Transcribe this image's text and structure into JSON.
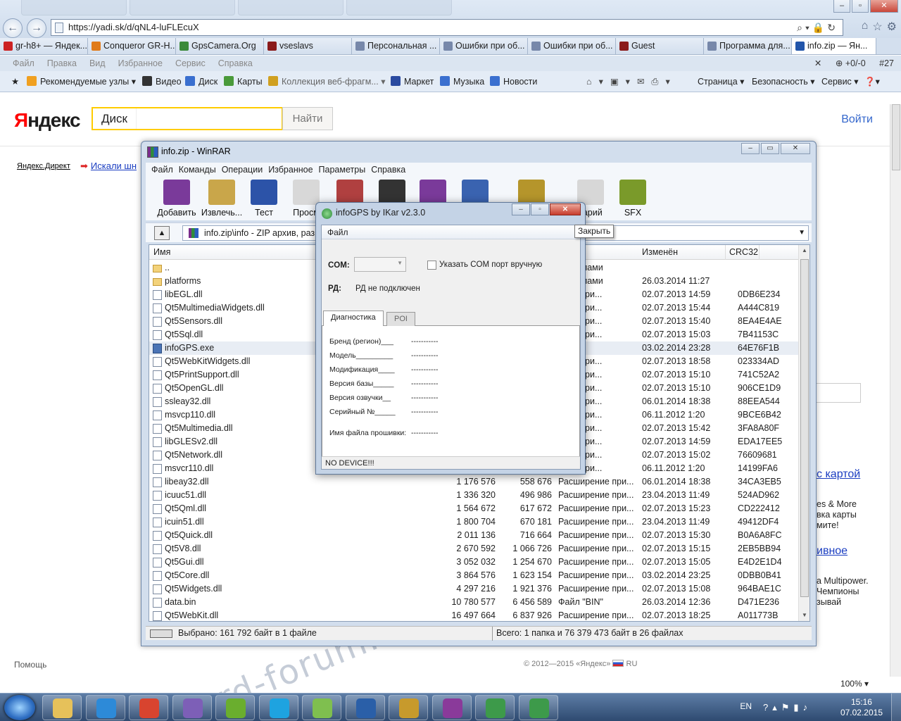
{
  "browser": {
    "address": "https://yadi.sk/d/qNL4-luFLEcuX",
    "tabs": [
      {
        "label": "gr-h8+ — Яндек...",
        "color": "#cc2222"
      },
      {
        "label": "Conqueror GR-H...",
        "color": "#e07b1a"
      },
      {
        "label": "GpsCamera.Org",
        "color": "#3a8a3a"
      },
      {
        "label": "vseslavs",
        "color": "#8a1a1a"
      },
      {
        "label": "Персональная ...",
        "color": "#7788aa"
      },
      {
        "label": "Ошибки при об...",
        "color": "#7788aa"
      },
      {
        "label": "Ошибки при об...",
        "color": "#7788aa"
      },
      {
        "label": "Guest",
        "color": "#8a1a1a"
      },
      {
        "label": "Программа для...",
        "color": "#7788aa"
      },
      {
        "label": "info.zip — Ян...",
        "color": "#2255aa"
      }
    ],
    "menu": [
      "Файл",
      "Правка",
      "Вид",
      "Избранное",
      "Сервис",
      "Справка"
    ],
    "menu_right": "+0/-0",
    "menu_right2": "#27",
    "favorites": [
      {
        "label": "Рекомендуемые узлы ▾",
        "gray": false
      },
      {
        "label": "Видео",
        "gray": false
      },
      {
        "label": "Диск",
        "gray": false
      },
      {
        "label": "Карты",
        "gray": false
      },
      {
        "label": "Коллекция веб-фрагм... ▾",
        "gray": true
      },
      {
        "label": "Маркет",
        "gray": false
      },
      {
        "label": "Музыка",
        "gray": false
      },
      {
        "label": "Новости",
        "gray": false
      }
    ],
    "commands": [
      "Страница ▾",
      "Безопасность ▾",
      "Сервис ▾"
    ]
  },
  "yandex": {
    "logo_red": "Я",
    "logo_rest": "ндекс",
    "search_tag": "Диск",
    "search_button": "Найти",
    "login": "Войти",
    "direct": "Яндекс.Директ",
    "link": "Искали шн",
    "right_link1": "с картой",
    "right_text1": [
      "es & More",
      "вка карты",
      "мите!"
    ],
    "right_link2": "ивное",
    "right_text2": [
      "а Multipower.",
      "Чемпионы",
      "зывай"
    ],
    "footer_left": "Помощь",
    "footer_right": "© 2012—2015 «Яндекс»",
    "footer_lang": "RU",
    "zoom": "100% ▾",
    "watermark": "rd-forum.ru"
  },
  "winrar": {
    "title": "info.zip - WinRAR",
    "menu": [
      "Файл",
      "Команды",
      "Операции",
      "Избранное",
      "Параметры",
      "Справка"
    ],
    "toolbar": [
      {
        "label": "Добавить",
        "color": "#7a3a9a"
      },
      {
        "label": "Извлечь...",
        "color": "#c9a64a"
      },
      {
        "label": "Тест",
        "color": "#2c53a8"
      },
      {
        "label": "Просм",
        "color": "#d8d8d8"
      },
      {
        "label": "",
        "color": "#b04040"
      },
      {
        "label": "",
        "color": "#333333"
      },
      {
        "label": "",
        "color": "#7a3a9a"
      },
      {
        "label": "",
        "color": "#3a63b0"
      },
      {
        "label": "",
        "color": "#b5952b"
      },
      {
        "label": "тарий",
        "color": "#d7d7d7"
      },
      {
        "label": "SFX",
        "color": "#7a9a2a"
      }
    ],
    "path": "info.zip\\info - ZIP архив, разм",
    "columns": {
      "name": "Имя",
      "modified": "Изменён",
      "crc": "CRC32"
    },
    "files": [
      {
        "name": "..",
        "size": "",
        "packed": "",
        "type": "с файлами",
        "modified": "",
        "crc": "",
        "kind": "dir"
      },
      {
        "name": "platforms",
        "size": "",
        "packed": "",
        "type": "с файлами",
        "modified": "26.03.2014 11:27",
        "crc": "",
        "kind": "dir"
      },
      {
        "name": "libEGL.dll",
        "size": "",
        "packed": "",
        "type": "ение при...",
        "modified": "02.07.2013 14:59",
        "crc": "0DB6E234",
        "kind": "file"
      },
      {
        "name": "Qt5MultimediaWidgets.dll",
        "size": "",
        "packed": "",
        "type": "ение при...",
        "modified": "02.07.2013 15:44",
        "crc": "A444C819",
        "kind": "file"
      },
      {
        "name": "Qt5Sensors.dll",
        "size": "",
        "packed": "",
        "type": "ение при...",
        "modified": "02.07.2013 15:40",
        "crc": "8EA4E4AE",
        "kind": "file"
      },
      {
        "name": "Qt5Sql.dll",
        "size": "",
        "packed": "",
        "type": "ение при...",
        "modified": "02.07.2013 15:03",
        "crc": "7B41153C",
        "kind": "file"
      },
      {
        "name": "infoGPS.exe",
        "size": "",
        "packed": "",
        "type": "жение",
        "modified": "03.02.2014 23:28",
        "crc": "64E76F1B",
        "kind": "exe"
      },
      {
        "name": "Qt5WebKitWidgets.dll",
        "size": "",
        "packed": "",
        "type": "ение при...",
        "modified": "02.07.2013 18:58",
        "crc": "023334AD",
        "kind": "file"
      },
      {
        "name": "Qt5PrintSupport.dll",
        "size": "",
        "packed": "",
        "type": "ение при...",
        "modified": "02.07.2013 15:10",
        "crc": "741C52A2",
        "kind": "file"
      },
      {
        "name": "Qt5OpenGL.dll",
        "size": "",
        "packed": "",
        "type": "ение при...",
        "modified": "02.07.2013 15:10",
        "crc": "906CE1D9",
        "kind": "file"
      },
      {
        "name": "ssleay32.dll",
        "size": "",
        "packed": "",
        "type": "ение при...",
        "modified": "06.01.2014 18:38",
        "crc": "88EEA544",
        "kind": "file"
      },
      {
        "name": "msvcp110.dll",
        "size": "",
        "packed": "",
        "type": "ение при...",
        "modified": "06.11.2012 1:20",
        "crc": "9BCE6B42",
        "kind": "file"
      },
      {
        "name": "Qt5Multimedia.dll",
        "size": "",
        "packed": "",
        "type": "ение при...",
        "modified": "02.07.2013 15:42",
        "crc": "3FA8A80F",
        "kind": "file"
      },
      {
        "name": "libGLESv2.dll",
        "size": "",
        "packed": "",
        "type": "ение при...",
        "modified": "02.07.2013 14:59",
        "crc": "EDA17EE5",
        "kind": "file"
      },
      {
        "name": "Qt5Network.dll",
        "size": "",
        "packed": "",
        "type": "ение при...",
        "modified": "02.07.2013 15:02",
        "crc": "76609681",
        "kind": "file"
      },
      {
        "name": "msvcr110.dll",
        "size": "",
        "packed": "",
        "type": "ение при...",
        "modified": "06.11.2012 1:20",
        "crc": "14199FA6",
        "kind": "file"
      },
      {
        "name": "libeay32.dll",
        "size": "1 176 576",
        "packed": "558 676",
        "type": "Расширение при...",
        "modified": "06.01.2014 18:38",
        "crc": "34CA3EB5",
        "kind": "file"
      },
      {
        "name": "icuuc51.dll",
        "size": "1 336 320",
        "packed": "496 986",
        "type": "Расширение при...",
        "modified": "23.04.2013 11:49",
        "crc": "524AD962",
        "kind": "file"
      },
      {
        "name": "Qt5Qml.dll",
        "size": "1 564 672",
        "packed": "617 672",
        "type": "Расширение при...",
        "modified": "02.07.2013 15:23",
        "crc": "CD222412",
        "kind": "file"
      },
      {
        "name": "icuin51.dll",
        "size": "1 800 704",
        "packed": "670 181",
        "type": "Расширение при...",
        "modified": "23.04.2013 11:49",
        "crc": "49412DF4",
        "kind": "file"
      },
      {
        "name": "Qt5Quick.dll",
        "size": "2 011 136",
        "packed": "716 664",
        "type": "Расширение при...",
        "modified": "02.07.2013 15:30",
        "crc": "B0A6A8FC",
        "kind": "file"
      },
      {
        "name": "Qt5V8.dll",
        "size": "2 670 592",
        "packed": "1 066 726",
        "type": "Расширение при...",
        "modified": "02.07.2013 15:15",
        "crc": "2EB5BB94",
        "kind": "file"
      },
      {
        "name": "Qt5Gui.dll",
        "size": "3 052 032",
        "packed": "1 254 670",
        "type": "Расширение при...",
        "modified": "02.07.2013 15:05",
        "crc": "E4D2E1D4",
        "kind": "file"
      },
      {
        "name": "Qt5Core.dll",
        "size": "3 864 576",
        "packed": "1 623 154",
        "type": "Расширение при...",
        "modified": "03.02.2014 23:25",
        "crc": "0DBB0B41",
        "kind": "file"
      },
      {
        "name": "Qt5Widgets.dll",
        "size": "4 297 216",
        "packed": "1 921 376",
        "type": "Расширение при...",
        "modified": "02.07.2013 15:08",
        "crc": "964BAE1C",
        "kind": "file"
      },
      {
        "name": "data.bin",
        "size": "10 780 577",
        "packed": "6 456 589",
        "type": "Файл \"BIN\"",
        "modified": "26.03.2014 12:36",
        "crc": "D471E236",
        "kind": "file"
      },
      {
        "name": "Qt5WebKit.dll",
        "size": "16 497 664",
        "packed": "6 837 926",
        "type": "Расширение при...",
        "modified": "02.07.2013 18:25",
        "crc": "A011773B",
        "kind": "file"
      }
    ],
    "status_left": "Выбрано: 161 792 байт в 1 файле",
    "status_right": "Всего: 1 папка и 76 379 473 байт в 26 файлах"
  },
  "infogps": {
    "title": "infoGPS  by IKar v2.3.0",
    "tooltip": "Закрыть",
    "menu": "Файл",
    "com_label": "COM:",
    "manual_com": "Указать COM  порт вручную",
    "rd_label": "РД:",
    "rd_value": "РД не подключен",
    "tabs": [
      "Диагностика",
      "POI"
    ],
    "fields": [
      {
        "label": "Бренд (регион)___",
        "value": "-----------"
      },
      {
        "label": "Модель_________",
        "value": "-----------"
      },
      {
        "label": "Модификация____",
        "value": "-----------"
      },
      {
        "label": "Версия базы_____",
        "value": "-----------"
      },
      {
        "label": "Версия озвучки__",
        "value": "-----------"
      },
      {
        "label": "Серийный №_____",
        "value": "-----------"
      }
    ],
    "firmware_label": "Имя файла прошивки:",
    "firmware_value": "-----------",
    "status": "NO DEVICE!!!"
  },
  "taskbar": {
    "apps": [
      {
        "name": "explorer",
        "color": "#e6c15a"
      },
      {
        "name": "ie",
        "color": "#2d8ad8"
      },
      {
        "name": "chrome",
        "color": "#d8442f"
      },
      {
        "name": "visual-studio",
        "color": "#7d5fb7"
      },
      {
        "name": "utorrent",
        "color": "#6aae2e"
      },
      {
        "name": "skype",
        "color": "#1ea3e0"
      },
      {
        "name": "app-green",
        "color": "#7fbf4f"
      },
      {
        "name": "google-earth",
        "color": "#2a5fa8"
      },
      {
        "name": "sc-app",
        "color": "#c79a2c"
      },
      {
        "name": "winrar",
        "color": "#8a3a9a"
      },
      {
        "name": "infogps",
        "color": "#3d9a4a"
      },
      {
        "name": "infogps-2",
        "color": "#3d9a4a"
      }
    ],
    "lang": "EN",
    "time": "15:16",
    "date": "07.02.2015"
  }
}
